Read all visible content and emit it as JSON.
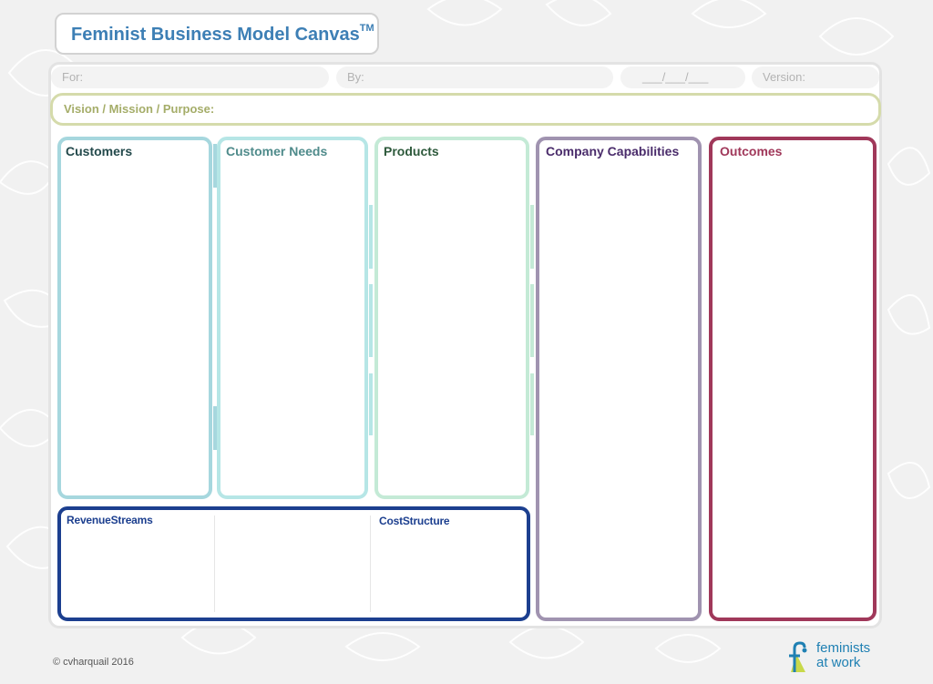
{
  "title": "Feminist Business Model Canvas",
  "title_mark": "TM",
  "header_fields": {
    "for": "For:",
    "by": "By:",
    "date": "___/___/___",
    "version": "Version:"
  },
  "vision": "Vision / Mission / Purpose:",
  "sections": {
    "customers": "Customers",
    "customer_needs": "Customer Needs",
    "products": "Products",
    "company_capabilities": "Company Capabilities",
    "outcomes": "Outcomes",
    "revenue_streams": "RevenueStreams",
    "cost_structure": "CostStructure"
  },
  "colors": {
    "customers": "#a6d7de",
    "customer_needs": "#b6e6e6",
    "products": "#c4ead6",
    "company_capabilities": "#a093b0",
    "outcomes": "#a0385a",
    "revenue_cost": "#1c3f8f",
    "title": "#3d7fb5"
  },
  "footer": {
    "copyright": "© cvharquail 2016",
    "logo_line1": "feminists",
    "logo_line2": "at work"
  }
}
